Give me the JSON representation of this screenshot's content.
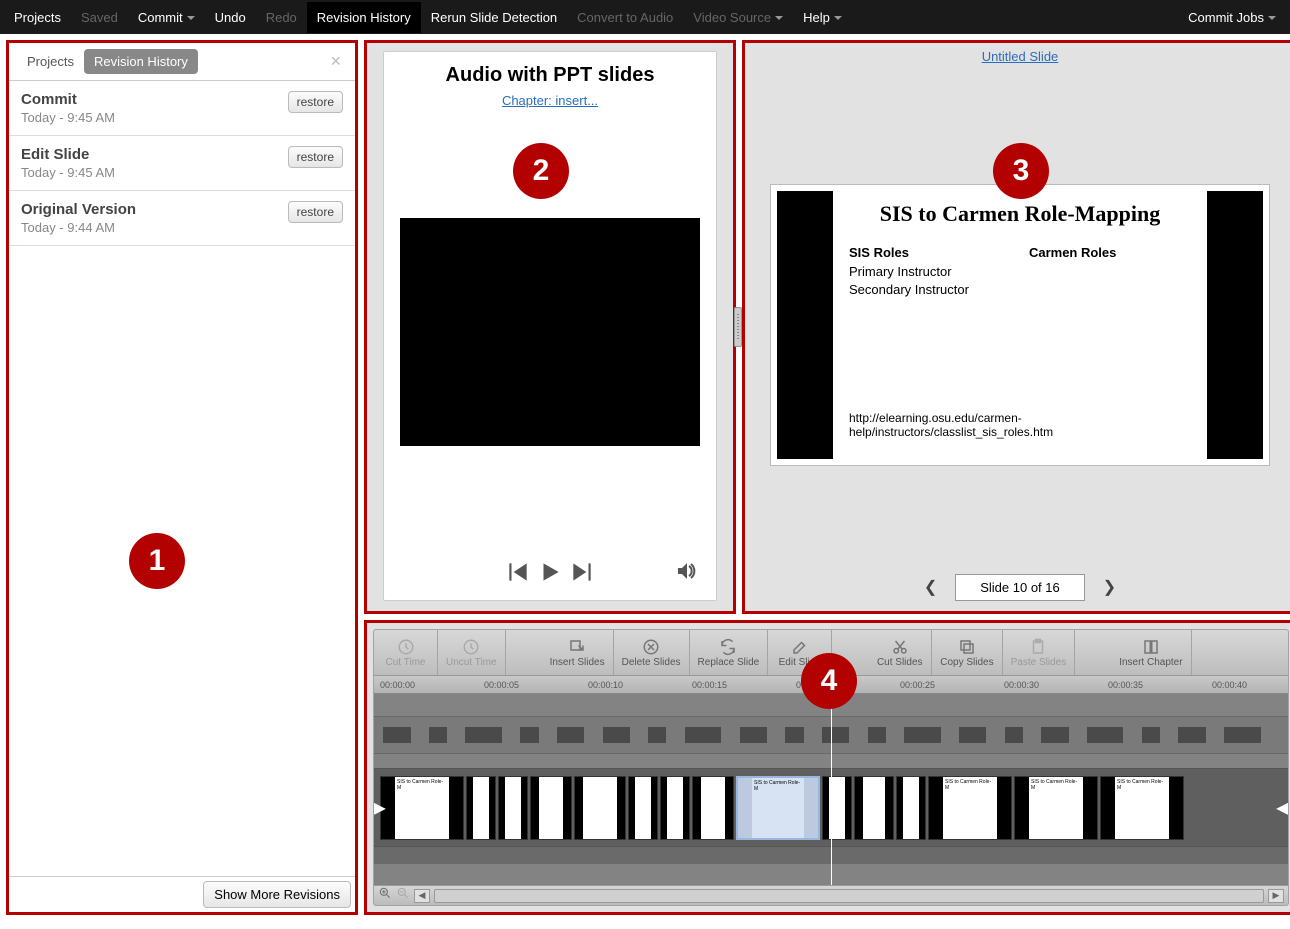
{
  "menubar": {
    "projects": "Projects",
    "saved": "Saved",
    "commit": "Commit",
    "undo": "Undo",
    "redo": "Redo",
    "revision_history": "Revision History",
    "rerun": "Rerun Slide Detection",
    "convert": "Convert to Audio",
    "video_source": "Video Source",
    "help": "Help",
    "commit_jobs": "Commit Jobs"
  },
  "badges": {
    "n1": "1",
    "n2": "2",
    "n3": "3",
    "n4": "4"
  },
  "panel1": {
    "tab_projects": "Projects",
    "tab_revision": "Revision History",
    "revisions": [
      {
        "title": "Commit",
        "time": "Today - 9:45 AM",
        "btn": "restore"
      },
      {
        "title": "Edit Slide",
        "time": "Today - 9:45 AM",
        "btn": "restore"
      },
      {
        "title": "Original Version",
        "time": "Today - 9:44 AM",
        "btn": "restore"
      }
    ],
    "show_more": "Show More Revisions"
  },
  "panel2": {
    "title": "Audio with PPT slides",
    "chapter": "Chapter: insert..."
  },
  "panel3": {
    "untitled": "Untitled Slide",
    "slide_title": "SIS to Carmen Role-Mapping",
    "col1_head": "SIS Roles",
    "col1_r1": "Primary Instructor",
    "col1_r2": "Secondary Instructor",
    "col2_head": "Carmen Roles",
    "url": "http://elearning.osu.edu/carmen-help/instructors/classlist_sis_roles.htm",
    "counter": "Slide 10 of 16"
  },
  "panel4": {
    "tools": {
      "cut_time": "Cut Time",
      "uncut_time": "Uncut Time",
      "insert_slides": "Insert Slides",
      "delete_slides": "Delete Slides",
      "replace_slide": "Replace Slide",
      "edit_slide": "Edit Slide",
      "cut_slides": "Cut Slides",
      "copy_slides": "Copy Slides",
      "paste_slides": "Paste Slides",
      "insert_chapter": "Insert Chapter"
    },
    "ruler": [
      "00:00:00",
      "00:00:05",
      "00:00:10",
      "00:00:15",
      "00:00:20",
      "00:00:25",
      "00:00:30",
      "00:00:35",
      "00:00:40"
    ],
    "thumb_label": "SIS to Carmen Role-M"
  }
}
